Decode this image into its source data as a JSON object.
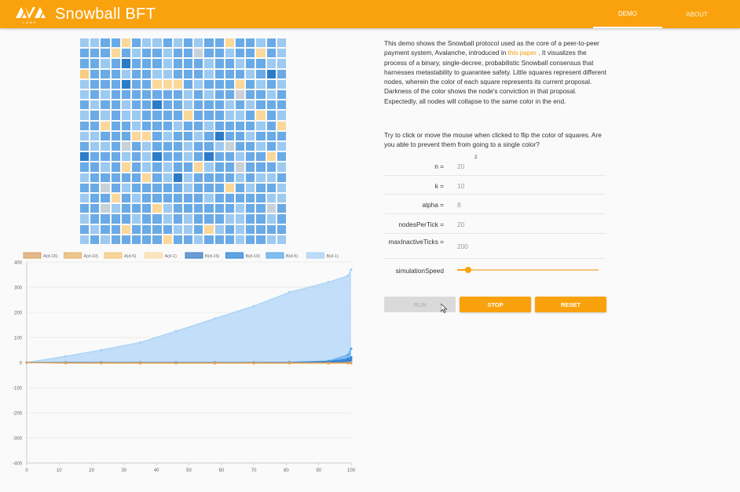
{
  "app": {
    "logo_text": "AVA LABS",
    "title": "Snowball BFT",
    "nav": [
      "DEMO",
      "ABOUT"
    ]
  },
  "colors": {
    "accent": "#f9a20d",
    "A_shades": [
      "#f3c572",
      "#f8cf7f",
      "#fbd89a",
      "#fde6c4"
    ],
    "B_shades": [
      "#1c6fc4",
      "#3b8ad6",
      "#6aaae6",
      "#94c4ef",
      "#b9daf5",
      "#c5cfd8"
    ]
  },
  "grid": {
    "size": 20,
    "rows": [
      "EEDDCDEEDEDEDDCDDEDE",
      "DDDCDEDDEDDFDDEDDCDE",
      "DDEDBDDDEDDDEDDEDDEE",
      "ADDDEDDEEDDDEDDDEDBD",
      "EDDDBDDCCCDEDDDCDEDE",
      "EDEDDDDDDDEDEDDFDDED",
      "DEDDEDDBDDEDDDEDEDDD",
      "EDEDEEDDDDCDDDEEDCDE",
      "DDCDDEDDDEDDEDDDDEDC",
      "EEDDDCCDEDDEDBDDEDDD",
      "DEEDFDEDDDEDDEFDDEDE",
      "BDDDEDEBDDEDBDDEDDCD",
      "DDEDCDEDEDDCEDDFDDDE",
      "EDDDDDCDEBEDDDDEDEED",
      "DDFDEDDDDDEDDDCDEDDE",
      "EDDCDEDDDDDDEDDDDDEE",
      "DDFEDDDCEDDDDDDEDDFD",
      "EDDDDEDDEDEDDDEEDDED",
      "DEDDCDDDDEEDCEDEDDDD",
      "EDEDDDDDCDDEDDDEDDEE"
    ],
    "palette": {
      "A": "#f8cd80",
      "B": "#2c7bc9",
      "C": "#fbd89a",
      "D": "#6aaae6",
      "E": "#9ccaf1",
      "F": "#c8d1d8"
    }
  },
  "description": {
    "part1": "This demo shows the Snowball protocol used as the core of a peer-to-peer payment system, Avalanche, introduced in ",
    "link": "this paper",
    "part2": " . It visualizes the process of a binary, single-decree, probabilistic Snowball consensus that harnesses metastability to guarantee safety. Little squares represent different nodes, wherein the color of each square represents its current proposal. Darkness of the color shows the node's conviction in that proposal. Expectedly, all nodes will collapse to the same color in the end.",
    "instructions": "Try to click or move the mouse when clicked to flip the color of squares. Are you able to prevent them from going to a single color?"
  },
  "params": [
    {
      "label": "n =",
      "value": "20",
      "sup": "2"
    },
    {
      "label": "k =",
      "value": "10"
    },
    {
      "label": "alpha =",
      "value": "8"
    },
    {
      "label": "nodesPerTick =",
      "value": "20"
    },
    {
      "label": "maxInactiveTicks =",
      "value": "200"
    }
  ],
  "slider": {
    "label": "simulationSpeed",
    "value": 0.08
  },
  "buttons": {
    "run": "RUN",
    "stop": "STOP",
    "reset": "RESET"
  },
  "chart_data": {
    "type": "line",
    "legend_position": "top",
    "x": [
      0,
      12,
      23,
      35,
      46,
      58,
      70,
      81,
      93,
      99,
      100
    ],
    "ylim": [
      -400,
      400
    ],
    "xticks": [
      0,
      10,
      20,
      30,
      40,
      50,
      60,
      70,
      80,
      90,
      100
    ],
    "yticks": [
      400,
      300,
      200,
      100,
      0,
      -100,
      -200,
      -300,
      -400
    ],
    "series": [
      {
        "name": "A(d-15)",
        "color": "#d9a066",
        "values": [
          0,
          -1,
          -1,
          -1,
          -1,
          -1,
          -1,
          -1,
          -1,
          -1,
          -1
        ]
      },
      {
        "name": "A(d-10)",
        "color": "#e8b36a",
        "values": [
          0,
          -2,
          -2,
          -2,
          -2,
          -2,
          -2,
          -2,
          -2,
          -2,
          -2
        ]
      },
      {
        "name": "A(d-5)",
        "color": "#f6c77b",
        "values": [
          0,
          -3,
          -3,
          -3,
          -3,
          -3,
          -3,
          -3,
          -3,
          -3,
          -3
        ]
      },
      {
        "name": "A(d-1)",
        "color": "#fbdcaa",
        "values": [
          0,
          -3,
          -4,
          -4,
          -4,
          -4,
          -4,
          -4,
          -4,
          -4,
          -4
        ]
      },
      {
        "name": "B(d-15)",
        "color": "#3b7dc4",
        "values": [
          0,
          0,
          0,
          0,
          0,
          0,
          0,
          0,
          2,
          8,
          10
        ]
      },
      {
        "name": "B(d-10)",
        "color": "#2e86d8",
        "values": [
          0,
          0,
          0,
          0,
          0,
          0,
          0,
          0,
          4,
          15,
          20
        ]
      },
      {
        "name": "B(d-5)",
        "color": "#5aa8ec",
        "values": [
          0,
          0,
          0,
          0,
          0,
          0,
          0,
          1,
          6,
          30,
          55
        ]
      },
      {
        "name": "B(d-1)",
        "color": "#a9d2f6",
        "values": [
          0,
          25,
          50,
          80,
          125,
          175,
          225,
          280,
          320,
          345,
          370
        ]
      }
    ]
  }
}
